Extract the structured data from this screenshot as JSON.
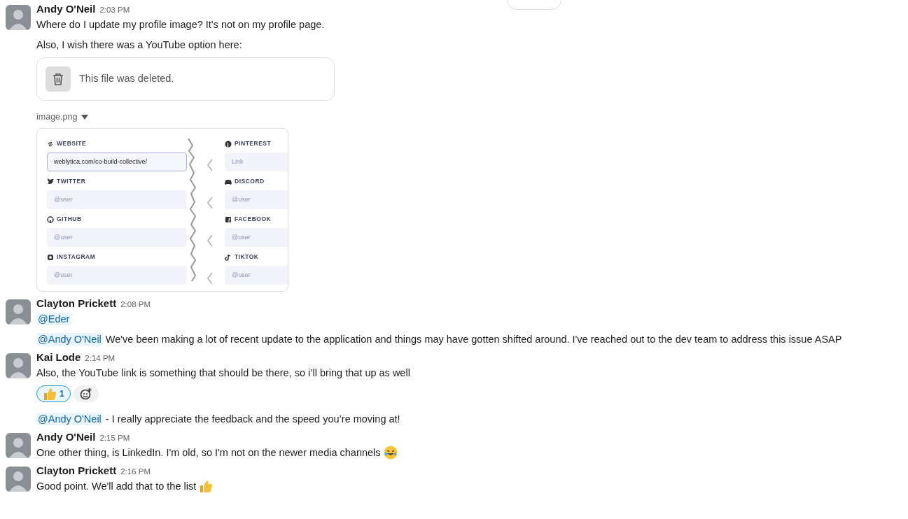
{
  "messages": [
    {
      "author": "Andy O'Neil",
      "time": "2:03 PM",
      "blocks": [
        {
          "kind": "text",
          "text": "Where do I update my profile image? It's not on my profile page."
        },
        {
          "kind": "text",
          "text": "Also, I wish there was a YouTube option here:"
        },
        {
          "kind": "deleted_file",
          "text": "This file was deleted."
        },
        {
          "kind": "image",
          "filename": "image.png",
          "screenshot": {
            "left_fields": [
              {
                "label": "WEBSITE",
                "value": "weblytica.com/co-build-collective/",
                "focused": true
              },
              {
                "label": "TWITTER",
                "placeholder": "@user",
                "focused": false
              },
              {
                "label": "GITHUB",
                "placeholder": "@user",
                "focused": false
              },
              {
                "label": "INSTAGRAM",
                "placeholder": "@user",
                "focused": false
              }
            ],
            "right_fields": [
              {
                "label": "PINTEREST",
                "placeholder": "Link",
                "focused": false
              },
              {
                "label": "DISCORD",
                "placeholder": "@user",
                "focused": false
              },
              {
                "label": "FACEBOOK",
                "placeholder": "@user",
                "focused": false
              },
              {
                "label": "TIKTOK",
                "placeholder": "@user",
                "focused": false
              }
            ]
          }
        }
      ]
    },
    {
      "author": "Clayton Prickett",
      "time": "2:08 PM",
      "blocks": [
        {
          "kind": "mention",
          "mention": "@Eder"
        },
        {
          "kind": "mention",
          "mention": "@Andy O'Neil",
          "text": "We've been making a lot of recent update to the application and things may have gotten shifted around. I've reached out to the dev team to address this issue ASAP"
        }
      ]
    },
    {
      "author": "Kai Lode",
      "time": "2:14 PM",
      "blocks": [
        {
          "kind": "text",
          "text": "Also, the YouTube link is something that should be there, so i’ll bring that up as well"
        },
        {
          "kind": "reactions",
          "reactions": [
            {
              "kind": "thumbs_up",
              "count": "1",
              "selected": true
            }
          ]
        },
        {
          "kind": "mention",
          "mention": "@Andy O'Neil",
          "text": "- I really appreciate the feedback and the speed you’re moving at!"
        }
      ]
    },
    {
      "author": "Andy O'Neil",
      "time": "2:15 PM",
      "blocks": [
        {
          "kind": "text",
          "text": "One other thing, is LinkedIn. I'm old, so I'm not on the newer media channels",
          "trailing_emoji": {
            "kind": "laughing"
          }
        }
      ]
    },
    {
      "author": "Clayton Prickett",
      "time": "2:16 PM",
      "blocks": [
        {
          "kind": "text",
          "text": "Good point. We'll add that to the list",
          "trailing_emoji": {
            "kind": "thumbs_up"
          }
        }
      ]
    }
  ]
}
